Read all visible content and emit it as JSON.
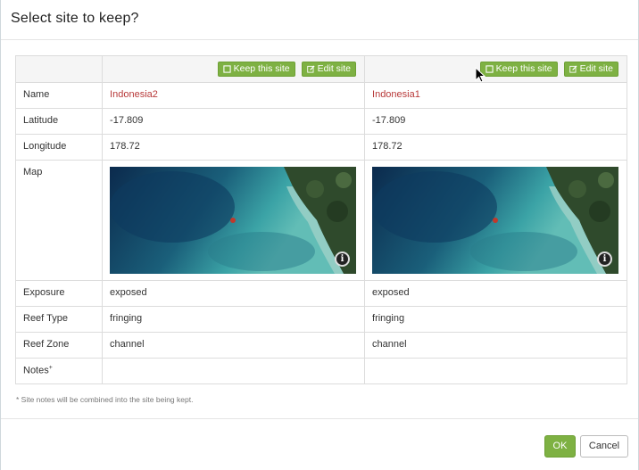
{
  "dialog": {
    "title": "Select site to keep?"
  },
  "actions": {
    "keep_label": "Keep this site",
    "edit_label": "Edit site"
  },
  "fields": {
    "name": "Name",
    "latitude": "Latitude",
    "longitude": "Longitude",
    "map": "Map",
    "exposure": "Exposure",
    "reef_type": "Reef Type",
    "reef_zone": "Reef Zone",
    "notes": "Notes",
    "notes_mark": "+"
  },
  "sites": [
    {
      "name": "Indonesia2",
      "latitude": "-17.809",
      "longitude": "178.72",
      "exposure": "exposed",
      "reef_type": "fringing",
      "reef_zone": "channel",
      "notes": ""
    },
    {
      "name": "Indonesia1",
      "latitude": "-17.809",
      "longitude": "178.72",
      "exposure": "exposed",
      "reef_type": "fringing",
      "reef_zone": "channel",
      "notes": ""
    }
  ],
  "map_info_glyph": "i",
  "footnote": "* Site notes will be combined into the site being kept.",
  "footer": {
    "ok_label": "OK",
    "cancel_label": "Cancel"
  },
  "colors": {
    "accent_green": "#7eb143",
    "site_name_red": "#b83a3a"
  }
}
